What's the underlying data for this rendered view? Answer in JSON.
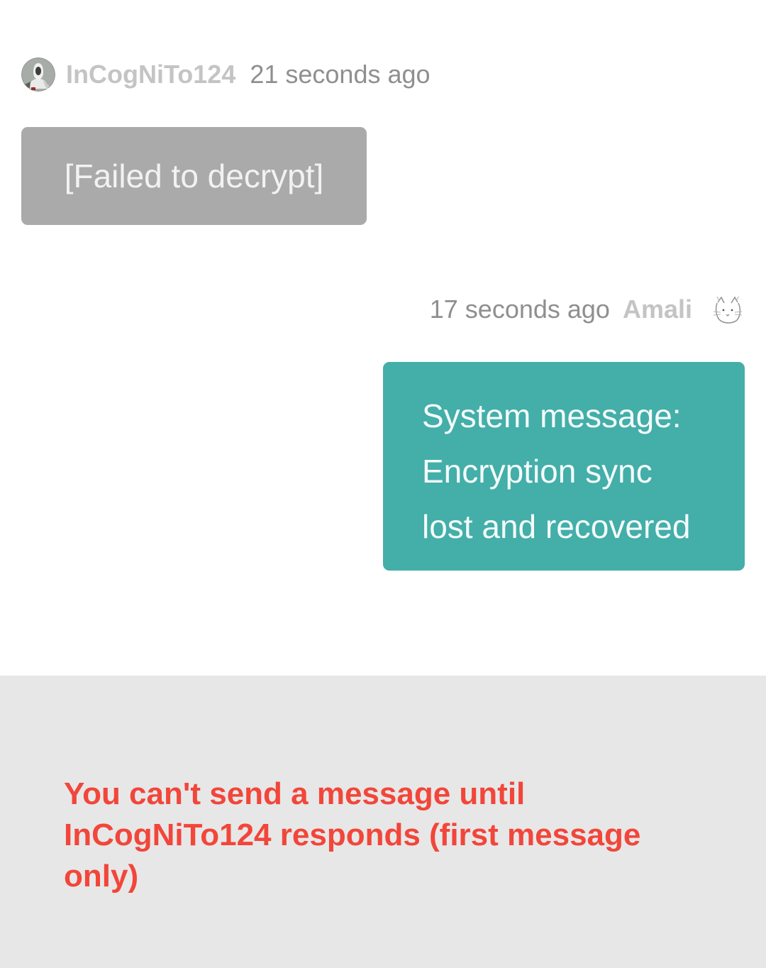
{
  "messages": [
    {
      "direction": "incoming",
      "sender": "InCogNiTo124",
      "time": "21 seconds ago",
      "avatar_icon": "avatar-hooded-figure-icon",
      "text": "[Failed to decrypt]"
    },
    {
      "direction": "outgoing",
      "sender": "Amali",
      "time": "17 seconds ago",
      "avatar_icon": "avatar-cat-sketch-icon",
      "lines": [
        "System message:",
        "Encryption sync",
        "lost and recovered"
      ]
    }
  ],
  "footer": {
    "notice": "You can't send a message until InCogNiTo124 responds (first message only)"
  },
  "colors": {
    "failed_bubble": "#aaaaaa",
    "system_bubble": "#44aea9",
    "notice_text": "#f2463a",
    "footer_bg": "#e7e7e7",
    "username": "#c4c4c4",
    "timestamp": "#8f8f8f"
  }
}
